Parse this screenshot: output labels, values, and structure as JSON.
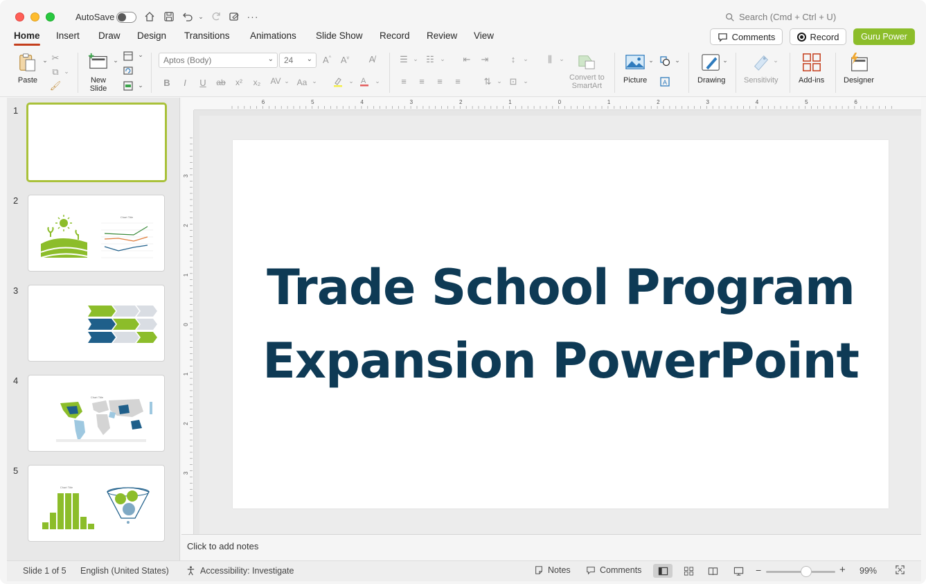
{
  "titlebar": {
    "autosave_label": "AutoSave",
    "search_placeholder": "Search (Cmd + Ctrl + U)"
  },
  "tabs": [
    {
      "label": "Home"
    },
    {
      "label": "Insert"
    },
    {
      "label": "Draw"
    },
    {
      "label": "Design"
    },
    {
      "label": "Transitions"
    },
    {
      "label": "Animations"
    },
    {
      "label": "Slide Show"
    },
    {
      "label": "Record"
    },
    {
      "label": "Review"
    },
    {
      "label": "View"
    }
  ],
  "header_buttons": {
    "comments": "Comments",
    "record": "Record",
    "guru": "Guru Power"
  },
  "ribbon": {
    "paste": "Paste",
    "new_slide_1": "New",
    "new_slide_2": "Slide",
    "font_name": "Aptos (Body)",
    "font_size": "24",
    "convert_1": "Convert to",
    "convert_2": "SmartArt",
    "picture": "Picture",
    "drawing": "Drawing",
    "sensitivity": "Sensitivity",
    "addins": "Add-ins",
    "designer": "Designer"
  },
  "ruler": {
    "h_ticks": [
      "6",
      "5",
      "4",
      "3",
      "2",
      "1",
      "0",
      "1",
      "2",
      "3",
      "4",
      "5",
      "6"
    ],
    "v_ticks": [
      "3",
      "2",
      "1",
      "0",
      "1",
      "2",
      "3"
    ]
  },
  "thumbnails": [
    {
      "num": "1"
    },
    {
      "num": "2",
      "chart_title": "Chart Title"
    },
    {
      "num": "3"
    },
    {
      "num": "4",
      "chart_title": "Chart Title"
    },
    {
      "num": "5",
      "chart_title": "Chart Title"
    }
  ],
  "slide": {
    "title_line1": "Trade School Program",
    "title_line2": "Expansion PowerPoint"
  },
  "notes_placeholder": "Click to add notes",
  "status": {
    "slide_info": "Slide 1 of 5",
    "language": "English (United States)",
    "accessibility": "Accessibility: Investigate",
    "notes": "Notes",
    "comments": "Comments",
    "zoom": "99%"
  },
  "colors": {
    "accent_red": "#c43e1c",
    "guru_green": "#8cbd2a",
    "title_navy": "#0e3a55",
    "thumb_green": "#a9c13a"
  }
}
